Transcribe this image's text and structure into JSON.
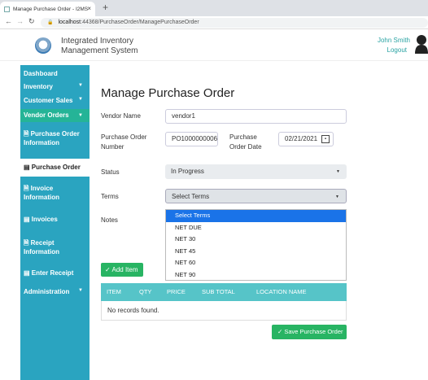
{
  "browser": {
    "tab_title": "Manage Purchase Order - I2MS",
    "tab_close": "×",
    "new_tab": "+",
    "url_host": "localhost",
    "url_rest": ":44368/PurchaseOrder/ManagePurchaseOrder"
  },
  "header": {
    "brand_line1": "Integrated Inventory",
    "brand_line2": "Management System",
    "user_name": "John Smith",
    "logout": "Logout"
  },
  "sidebar": {
    "items": [
      {
        "label": "Dashboard"
      },
      {
        "label": "Inventory"
      },
      {
        "label": "Customer Sales"
      },
      {
        "label": "Vendor Orders"
      },
      {
        "label": "Purchase Order Information"
      },
      {
        "label": "Purchase Order"
      },
      {
        "label": "Invoice Information"
      },
      {
        "label": "Invoices"
      },
      {
        "label": "Receipt Information"
      },
      {
        "label": "Enter Receipt"
      },
      {
        "label": "Administration"
      }
    ]
  },
  "main": {
    "title": "Manage Purchase Order",
    "vendor_label": "Vendor Name",
    "vendor_value": "vendor1",
    "po_number_label": "Purchase Order Number",
    "po_number_value": "PO1000000006",
    "po_date_label": "Purchase Order Date",
    "po_date_value": "02/21/2021",
    "status_label": "Status",
    "status_value": "In Progress",
    "terms_label": "Terms",
    "terms_value": "Select Terms",
    "notes_label": "Notes",
    "terms_options": [
      "Select Terms",
      "NET DUE",
      "NET 30",
      "NET 45",
      "NET 60",
      "NET 90"
    ],
    "add_item": "Add Item",
    "table_headers": [
      "ITEM",
      "QTY",
      "PRICE",
      "SUB TOTAL",
      "LOCATION NAME"
    ],
    "empty_text": "No records found.",
    "save_button": "Save Purchase Order"
  },
  "colors": {
    "sidebar": "#2aa4c0",
    "sidebar_active": "#25b497",
    "accent_button": "#28b463",
    "table_header": "#56c4c8",
    "dropdown_selected": "#1a73e8"
  }
}
